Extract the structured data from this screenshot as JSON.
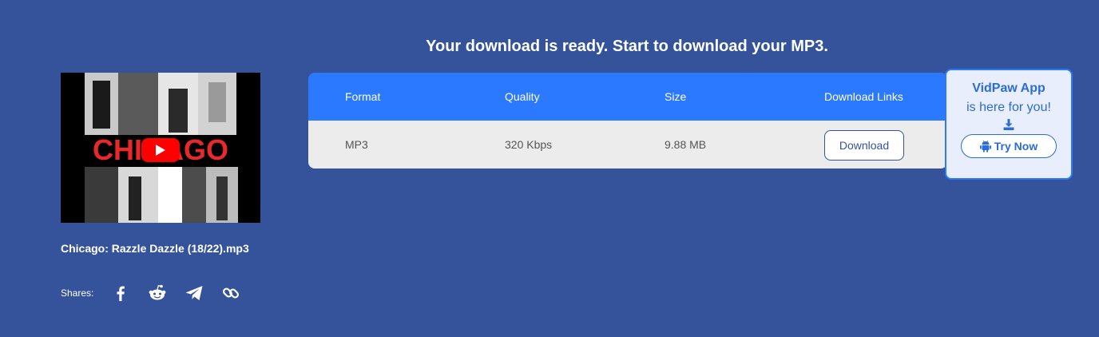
{
  "heading": "Your download is ready. Start to download your MP3.",
  "media": {
    "filename": "Chicago: Razzle Dazzle (18/22).mp3",
    "thumbnail_text": "CHICAGO",
    "play_icon": "youtube-play-icon"
  },
  "shares": {
    "label": "Shares:",
    "icons": [
      "facebook-icon",
      "reddit-icon",
      "telegram-icon",
      "link-icon"
    ]
  },
  "table": {
    "headers": [
      "Format",
      "Quality",
      "Size",
      "Download Links"
    ],
    "rows": [
      {
        "format": "MP3",
        "quality": "320 Kbps",
        "size": "9.88 MB",
        "action": "Download"
      }
    ]
  },
  "promo": {
    "title": "VidPaw App",
    "subtitle": "is here for you!",
    "icon": "download-icon",
    "button_label": "Try Now",
    "button_icon": "android-icon"
  },
  "colors": {
    "background": "#34539b",
    "table_header": "#2b79ff",
    "table_row": "#ececec",
    "promo_accent": "#2b6cdb"
  }
}
